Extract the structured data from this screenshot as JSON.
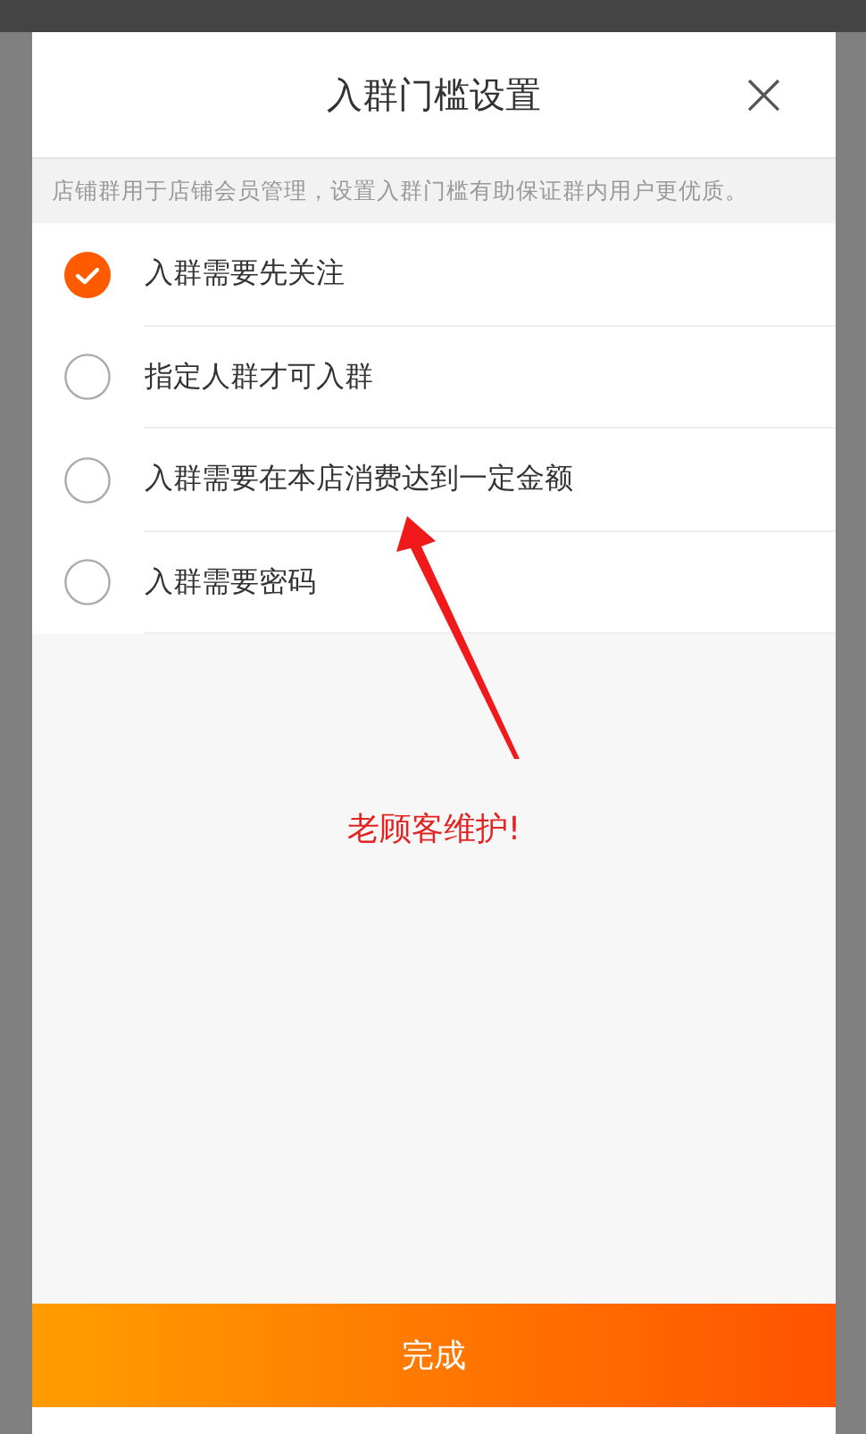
{
  "dialog": {
    "title": "入群门槛设置",
    "close": "×",
    "notice": "店铺群用于店铺会员管理，设置入群门槛有助保证群内用户更优质。",
    "options": [
      {
        "label": "入群需要先关注",
        "selected": true
      },
      {
        "label": "指定人群才可入群",
        "selected": false
      },
      {
        "label": "入群需要在本店消费达到一定金额",
        "selected": false
      },
      {
        "label": "入群需要密码",
        "selected": false
      }
    ],
    "annotation": "老顾客维护!",
    "button": "完成"
  }
}
